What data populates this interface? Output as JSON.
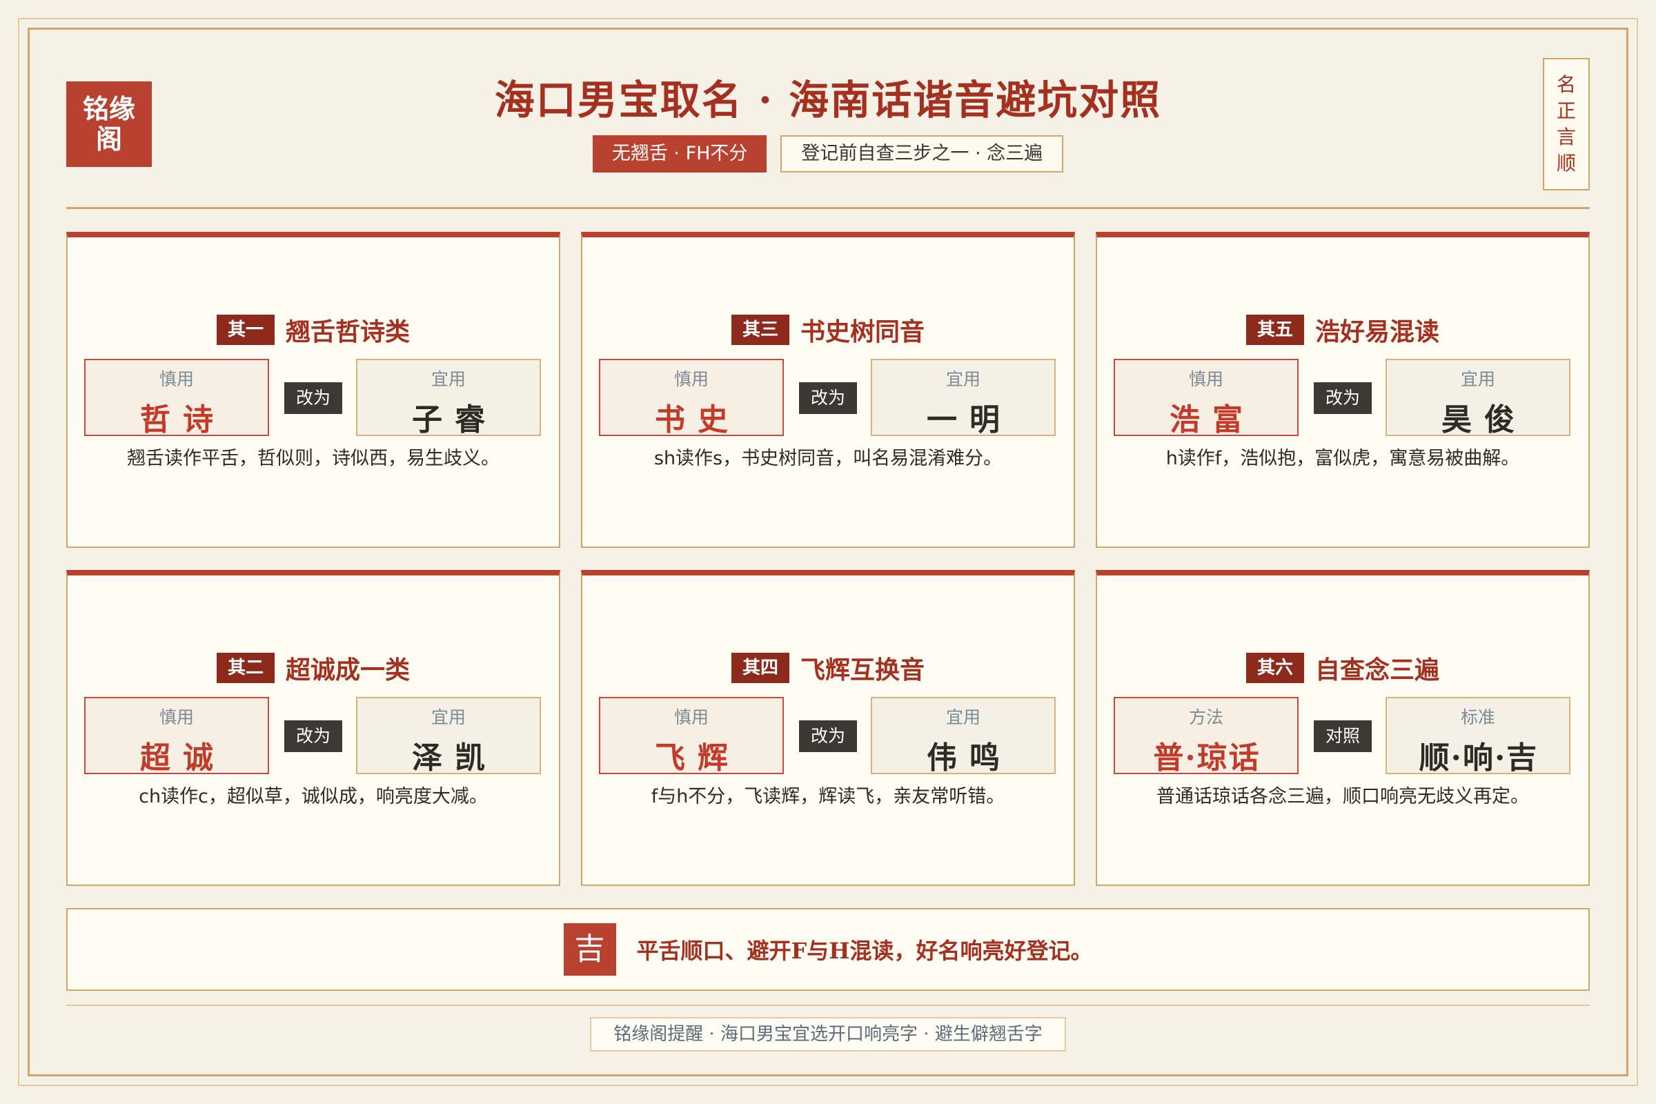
{
  "header": {
    "logo": "铭缘阁",
    "title": "海口男宝取名 · 海南话谐音避坑对照",
    "tag_primary": "无翘舌 · FH不分",
    "tag_secondary": "登记前自查三步之一 · 念三遍",
    "seal": [
      "名",
      "正",
      "言",
      "顺"
    ]
  },
  "cards": [
    {
      "num": "其一",
      "title": "翘舌哲诗类",
      "left_label": "慎用",
      "left_chars": "哲诗",
      "action": "改为",
      "right_label": "宜用",
      "right_chars": "子睿",
      "desc": "翘舌读作平舌，哲似则，诗似西，易生歧义。"
    },
    {
      "num": "其三",
      "title": "书史树同音",
      "left_label": "慎用",
      "left_chars": "书史",
      "action": "改为",
      "right_label": "宜用",
      "right_chars": "一明",
      "desc": "sh读作s，书史树同音，叫名易混淆难分。"
    },
    {
      "num": "其五",
      "title": "浩好易混读",
      "left_label": "慎用",
      "left_chars": "浩富",
      "action": "改为",
      "right_label": "宜用",
      "right_chars": "昊俊",
      "desc": "h读作f，浩似抱，富似虎，寓意易被曲解。"
    },
    {
      "num": "其二",
      "title": "超诚成一类",
      "left_label": "慎用",
      "left_chars": "超诚",
      "action": "改为",
      "right_label": "宜用",
      "right_chars": "泽凯",
      "desc": "ch读作c，超似草，诚似成，响亮度大减。"
    },
    {
      "num": "其四",
      "title": "飞辉互换音",
      "left_label": "慎用",
      "left_chars": "飞辉",
      "action": "改为",
      "right_label": "宜用",
      "right_chars": "伟鸣",
      "desc": "f与h不分，飞读辉，辉读飞，亲友常听错。"
    },
    {
      "num": "其六",
      "title": "自查念三遍",
      "left_label": "方法",
      "left_chars": "普·琼话",
      "action": "对照",
      "right_label": "标准",
      "right_chars": "顺·响·吉",
      "desc": "普通话琼话各念三遍，顺口响亮无歧义再定。"
    }
  ],
  "banner": {
    "icon": "吉",
    "text": "平舌顺口、避开F与H混读，好名响亮好登记。"
  },
  "footer": "铭缘阁提醒 · 海口男宝宜选开口响亮字 · 避生僻翘舌字"
}
